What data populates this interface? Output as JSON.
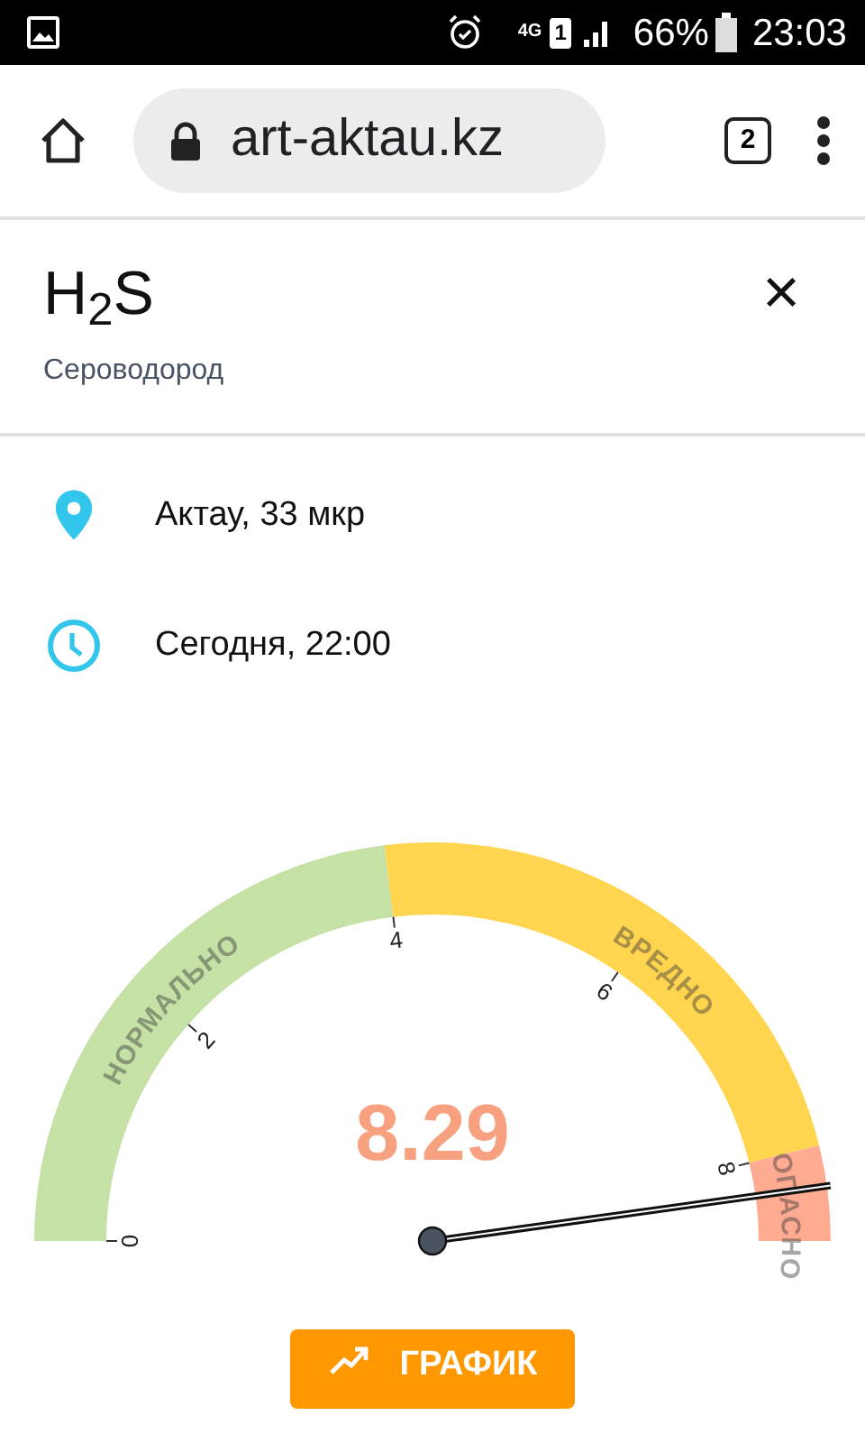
{
  "status_bar": {
    "network": "4G",
    "sim": "1",
    "battery": "66%",
    "time": "23:03"
  },
  "browser": {
    "url": "art-aktau.kz",
    "tab_count": "2"
  },
  "header": {
    "formula": "H$_{2}$S",
    "name": "Сероводород",
    "close": "×"
  },
  "info": [
    {
      "kind": "location",
      "text": "Актау, 33 мкр"
    },
    {
      "kind": "time",
      "text": "Сегодня, 22:00"
    }
  ],
  "gauge": {
    "value": "8.29",
    "bands": [
      {
        "label": "НОРМАЛЬНО",
        "color": "#c5e1a5"
      },
      {
        "label": "ВРЕДНО",
        "color": "#ffd54f"
      },
      {
        "label": "ОПАСНО",
        "color": "#ffab91"
      }
    ],
    "ticks": [
      "0",
      "2",
      "4",
      "6",
      "8"
    ]
  },
  "button": {
    "label": "ГРАФИК"
  }
}
